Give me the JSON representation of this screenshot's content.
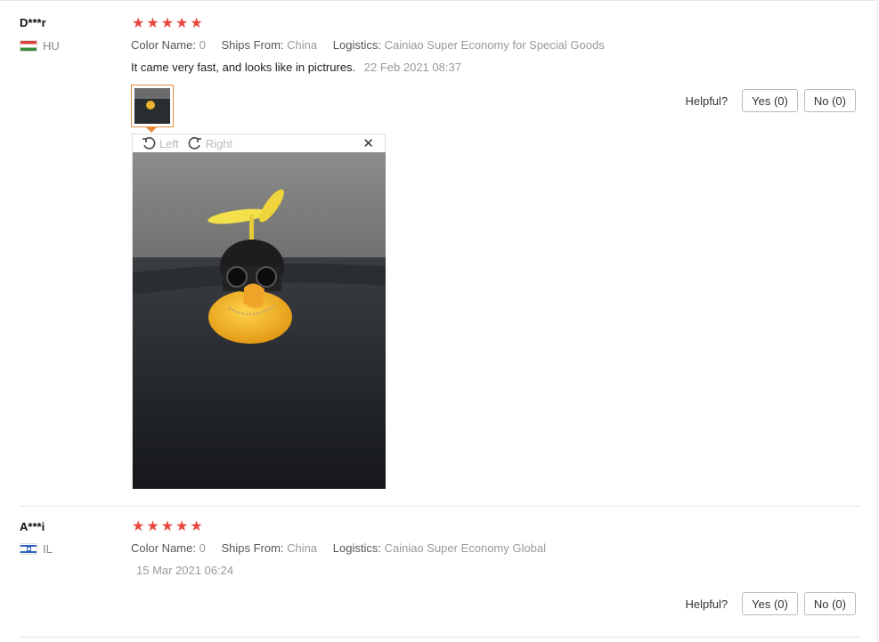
{
  "reviews": [
    {
      "user": "D***r",
      "country": "HU",
      "stars": 5,
      "attrs": {
        "color_key": "Color Name:",
        "color_val": "0",
        "ships_key": "Ships From:",
        "ships_val": "China",
        "log_key": "Logistics:",
        "log_val": "Cainiao Super Economy for Special Goods"
      },
      "comment": "It came very fast, and looks like in pictrures.",
      "date": "22 Feb 2021 08:37",
      "helpful_label": "Helpful?",
      "yes_label": "Yes (0)",
      "no_label": "No (0)"
    },
    {
      "user": "A***i",
      "country": "IL",
      "stars": 5,
      "attrs": {
        "color_key": "Color Name:",
        "color_val": "0",
        "ships_key": "Ships From:",
        "ships_val": "China",
        "log_key": "Logistics:",
        "log_val": "Cainiao Super Economy Global"
      },
      "comment": "",
      "date": "15 Mar 2021 06:24",
      "helpful_label": "Helpful?",
      "yes_label": "Yes (0)",
      "no_label": "No (0)"
    }
  ],
  "viewer": {
    "left_label": "Left",
    "right_label": "Right",
    "close_glyph": "✕"
  },
  "icons": {
    "star": "★",
    "rotate_left": "rotate-left-icon",
    "rotate_right": "rotate-right-icon",
    "close": "close-icon"
  },
  "colors": {
    "star": "#e8463e",
    "thumb_border": "#e58c3c"
  }
}
